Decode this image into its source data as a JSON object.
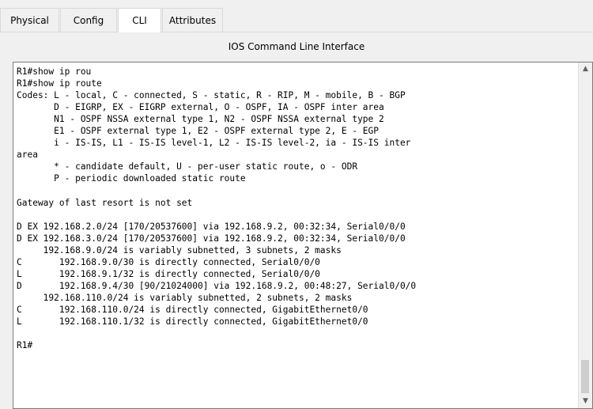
{
  "tabs": [
    {
      "label": "Physical"
    },
    {
      "label": "Config"
    },
    {
      "label": "CLI"
    },
    {
      "label": "Attributes"
    }
  ],
  "active_tab": "CLI",
  "cli_title": "IOS Command Line Interface",
  "terminal_lines": [
    "R1#show ip rou",
    "R1#show ip route",
    "Codes: L - local, C - connected, S - static, R - RIP, M - mobile, B - BGP",
    "       D - EIGRP, EX - EIGRP external, O - OSPF, IA - OSPF inter area",
    "       N1 - OSPF NSSA external type 1, N2 - OSPF NSSA external type 2",
    "       E1 - OSPF external type 1, E2 - OSPF external type 2, E - EGP",
    "       i - IS-IS, L1 - IS-IS level-1, L2 - IS-IS level-2, ia - IS-IS inter",
    "area",
    "       * - candidate default, U - per-user static route, o - ODR",
    "       P - periodic downloaded static route",
    "",
    "Gateway of last resort is not set",
    "",
    "D EX 192.168.2.0/24 [170/20537600] via 192.168.9.2, 00:32:34, Serial0/0/0",
    "D EX 192.168.3.0/24 [170/20537600] via 192.168.9.2, 00:32:34, Serial0/0/0",
    "     192.168.9.0/24 is variably subnetted, 3 subnets, 2 masks",
    "C       192.168.9.0/30 is directly connected, Serial0/0/0",
    "L       192.168.9.1/32 is directly connected, Serial0/0/0",
    "D       192.168.9.4/30 [90/21024000] via 192.168.9.2, 00:48:27, Serial0/0/0",
    "     192.168.110.0/24 is variably subnetted, 2 subnets, 2 masks",
    "C       192.168.110.0/24 is directly connected, GigabitEthernet0/0",
    "L       192.168.110.1/32 is directly connected, GigabitEthernet0/0",
    "",
    "R1#"
  ],
  "icons": {
    "scroll_up": "chevron-up-icon",
    "scroll_down": "chevron-down-icon"
  },
  "colors": {
    "background": "#f0f0f0",
    "terminal_bg": "#ffffff",
    "terminal_text": "#000000"
  }
}
